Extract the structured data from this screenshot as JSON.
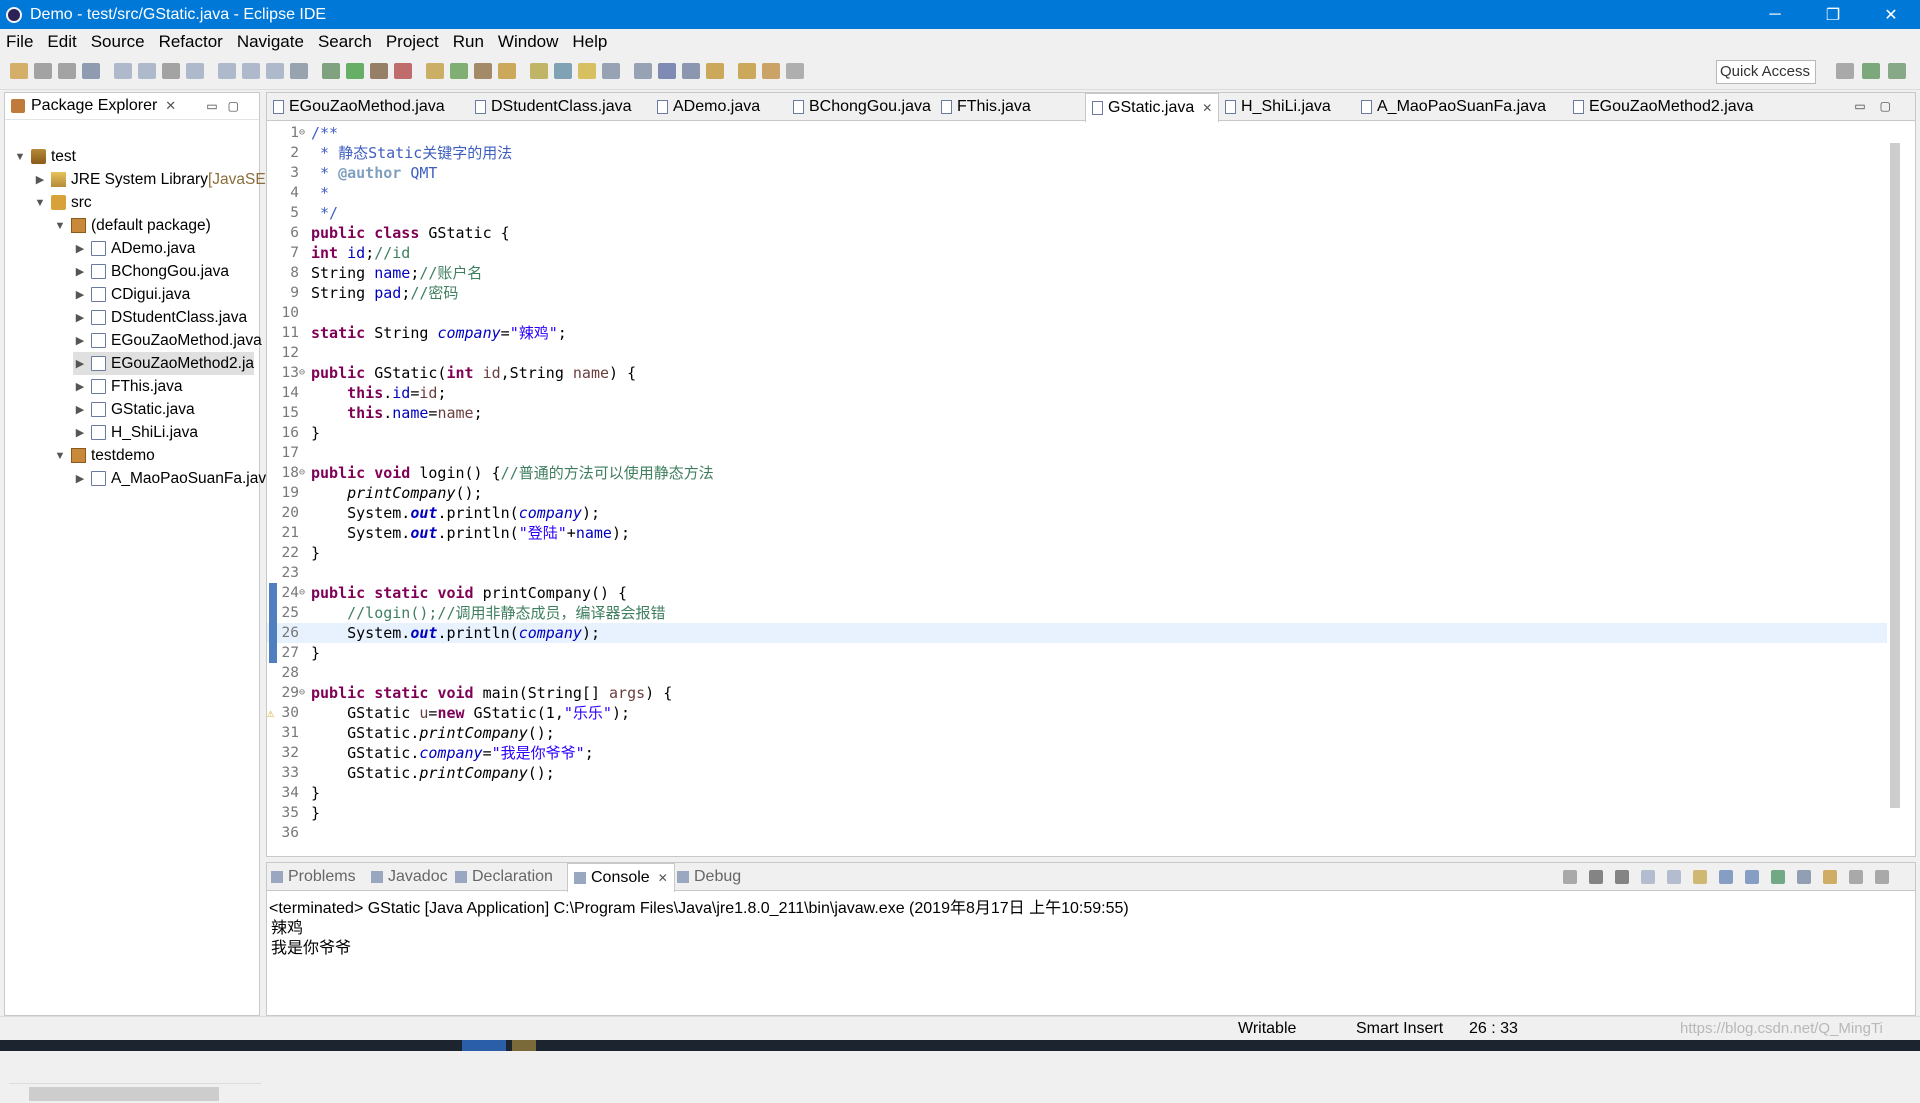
{
  "window": {
    "title": "Demo - test/src/GStatic.java - Eclipse IDE",
    "controls": {
      "minimize": "─",
      "restore": "❐",
      "close": "✕"
    }
  },
  "menu": [
    "File",
    "Edit",
    "Source",
    "Refactor",
    "Navigate",
    "Search",
    "Project",
    "Run",
    "Window",
    "Help"
  ],
  "quick_access": "Quick Access",
  "package_explorer": {
    "title": "Package Explorer",
    "tree": [
      {
        "label": "test",
        "depth": 0,
        "expanded": true,
        "icon": "project-icon"
      },
      {
        "label": "JRE System Library",
        "suffix": "[JavaSE",
        "depth": 1,
        "expanded": false,
        "icon": "library-icon"
      },
      {
        "label": "src",
        "depth": 1,
        "expanded": true,
        "icon": "source-folder-icon"
      },
      {
        "label": "(default package)",
        "depth": 2,
        "expanded": true,
        "icon": "package-icon"
      },
      {
        "label": "ADemo.java",
        "depth": 3,
        "expanded": false,
        "icon": "java-file-icon"
      },
      {
        "label": "BChongGou.java",
        "depth": 3,
        "expanded": false,
        "icon": "java-file-icon"
      },
      {
        "label": "CDigui.java",
        "depth": 3,
        "expanded": false,
        "icon": "java-file-icon"
      },
      {
        "label": "DStudentClass.java",
        "depth": 3,
        "expanded": false,
        "icon": "java-file-icon"
      },
      {
        "label": "EGouZaoMethod.java",
        "depth": 3,
        "expanded": false,
        "icon": "java-file-icon"
      },
      {
        "label": "EGouZaoMethod2.ja",
        "depth": 3,
        "expanded": false,
        "icon": "java-file-icon",
        "selected": true
      },
      {
        "label": "FThis.java",
        "depth": 3,
        "expanded": false,
        "icon": "java-file-icon"
      },
      {
        "label": "GStatic.java",
        "depth": 3,
        "expanded": false,
        "icon": "java-file-icon"
      },
      {
        "label": "H_ShiLi.java",
        "depth": 3,
        "expanded": false,
        "icon": "java-file-icon"
      },
      {
        "label": "testdemo",
        "depth": 2,
        "expanded": true,
        "icon": "package-icon"
      },
      {
        "label": "A_MaoPaoSuanFa.jav",
        "depth": 3,
        "expanded": false,
        "icon": "java-file-icon"
      }
    ]
  },
  "editor": {
    "tabs": [
      {
        "label": "EGouZaoMethod.java"
      },
      {
        "label": "DStudentClass.java"
      },
      {
        "label": "ADemo.java"
      },
      {
        "label": "BChongGou.java"
      },
      {
        "label": "FThis.java"
      },
      {
        "label": "GStatic.java",
        "active": true
      },
      {
        "label": "H_ShiLi.java"
      },
      {
        "label": "A_MaoPaoSuanFa.java"
      },
      {
        "label": "EGouZaoMethod2.java"
      }
    ],
    "current_line": 26,
    "lines": [
      {
        "n": "1",
        "fold": "⊖",
        "parts": [
          [
            "jd",
            "/**"
          ]
        ]
      },
      {
        "n": "2",
        "parts": [
          [
            "jd",
            " * 静态Static关键字的用法"
          ]
        ]
      },
      {
        "n": "3",
        "parts": [
          [
            "jd",
            " * "
          ],
          [
            "jt",
            "@author"
          ],
          [
            "jd",
            " QMT"
          ]
        ]
      },
      {
        "n": "4",
        "parts": [
          [
            "jd",
            " *"
          ]
        ]
      },
      {
        "n": "5",
        "parts": [
          [
            "jd",
            " */"
          ]
        ]
      },
      {
        "n": "6",
        "parts": [
          [
            "k",
            "public"
          ],
          [
            "",
            " "
          ],
          [
            "k",
            "class"
          ],
          [
            "",
            " GStatic {"
          ]
        ]
      },
      {
        "n": "7",
        "parts": [
          [
            "k",
            "int"
          ],
          [
            "",
            " "
          ],
          [
            "f",
            "id"
          ],
          [
            "",
            ";"
          ],
          [
            "c",
            "//id"
          ]
        ]
      },
      {
        "n": "8",
        "parts": [
          [
            "",
            "String "
          ],
          [
            "f",
            "name"
          ],
          [
            "",
            ";"
          ],
          [
            "c",
            "//账户名"
          ]
        ]
      },
      {
        "n": "9",
        "parts": [
          [
            "",
            "String "
          ],
          [
            "f",
            "pad"
          ],
          [
            "",
            ";"
          ],
          [
            "c",
            "//密码"
          ]
        ]
      },
      {
        "n": "10",
        "parts": []
      },
      {
        "n": "11",
        "parts": [
          [
            "k",
            "static"
          ],
          [
            "",
            " String "
          ],
          [
            "sf",
            "company"
          ],
          [
            "",
            "="
          ],
          [
            "s",
            "\"辣鸡\""
          ],
          [
            "",
            ";"
          ]
        ]
      },
      {
        "n": "12",
        "parts": []
      },
      {
        "n": "13",
        "fold": "⊖",
        "parts": [
          [
            "k",
            "public"
          ],
          [
            "",
            " GStatic("
          ],
          [
            "k",
            "int"
          ],
          [
            "",
            " "
          ],
          [
            "lv",
            "id"
          ],
          [
            "",
            ",String "
          ],
          [
            "lv",
            "name"
          ],
          [
            "",
            ") {"
          ]
        ]
      },
      {
        "n": "14",
        "parts": [
          [
            "",
            "    "
          ],
          [
            "k",
            "this"
          ],
          [
            "",
            "."
          ],
          [
            "f",
            "id"
          ],
          [
            "",
            "="
          ],
          [
            "lv",
            "id"
          ],
          [
            "",
            ";"
          ]
        ]
      },
      {
        "n": "15",
        "parts": [
          [
            "",
            "    "
          ],
          [
            "k",
            "this"
          ],
          [
            "",
            "."
          ],
          [
            "f",
            "name"
          ],
          [
            "",
            "="
          ],
          [
            "lv",
            "name"
          ],
          [
            "",
            ";"
          ]
        ]
      },
      {
        "n": "16",
        "parts": [
          [
            "",
            "}"
          ]
        ]
      },
      {
        "n": "17",
        "parts": []
      },
      {
        "n": "18",
        "fold": "⊖",
        "parts": [
          [
            "k",
            "public"
          ],
          [
            "",
            " "
          ],
          [
            "k",
            "void"
          ],
          [
            "",
            " login() {"
          ],
          [
            "c",
            "//普通的方法可以使用静态方法"
          ]
        ]
      },
      {
        "n": "19",
        "parts": [
          [
            "",
            "    "
          ],
          [
            "sm",
            "printCompany"
          ],
          [
            "",
            "();"
          ]
        ]
      },
      {
        "n": "20",
        "parts": [
          [
            "",
            "    System."
          ],
          [
            "sfo",
            "out"
          ],
          [
            "",
            ".println("
          ],
          [
            "sf",
            "company"
          ],
          [
            "",
            ");"
          ]
        ]
      },
      {
        "n": "21",
        "parts": [
          [
            "",
            "    System."
          ],
          [
            "sfo",
            "out"
          ],
          [
            "",
            ".println("
          ],
          [
            "s",
            "\"登陆\""
          ],
          [
            "",
            "+"
          ],
          [
            "f",
            "name"
          ],
          [
            "",
            ");"
          ]
        ]
      },
      {
        "n": "22",
        "parts": [
          [
            "",
            "}"
          ]
        ]
      },
      {
        "n": "23",
        "parts": []
      },
      {
        "n": "24",
        "fold": "⊖",
        "parts": [
          [
            "k",
            "public"
          ],
          [
            "",
            " "
          ],
          [
            "k",
            "static"
          ],
          [
            "",
            " "
          ],
          [
            "k",
            "void"
          ],
          [
            "",
            " printCompany() {"
          ]
        ]
      },
      {
        "n": "25",
        "parts": [
          [
            "",
            "    "
          ],
          [
            "c",
            "//login();//调用非静态成员，编译器会报错"
          ]
        ]
      },
      {
        "n": "26",
        "parts": [
          [
            "",
            "    System."
          ],
          [
            "sfo",
            "out"
          ],
          [
            "",
            ".println("
          ],
          [
            "sf",
            "company"
          ],
          [
            "",
            ");"
          ]
        ]
      },
      {
        "n": "27",
        "parts": [
          [
            "",
            "}"
          ]
        ]
      },
      {
        "n": "28",
        "parts": []
      },
      {
        "n": "29",
        "fold": "⊖",
        "parts": [
          [
            "k",
            "public"
          ],
          [
            "",
            " "
          ],
          [
            "k",
            "static"
          ],
          [
            "",
            " "
          ],
          [
            "k",
            "void"
          ],
          [
            "",
            " main(String[] "
          ],
          [
            "lv",
            "args"
          ],
          [
            "",
            ") {"
          ]
        ]
      },
      {
        "n": "30",
        "warn": true,
        "parts": [
          [
            "",
            "    GStatic "
          ],
          [
            "lv",
            "u"
          ],
          [
            "",
            "="
          ],
          [
            "k",
            "new"
          ],
          [
            "",
            " GStatic(1,"
          ],
          [
            "s",
            "\"乐乐\""
          ],
          [
            "",
            ");"
          ]
        ]
      },
      {
        "n": "31",
        "parts": [
          [
            "",
            "    GStatic."
          ],
          [
            "sm",
            "printCompany"
          ],
          [
            "",
            "();"
          ]
        ]
      },
      {
        "n": "32",
        "parts": [
          [
            "",
            "    GStatic."
          ],
          [
            "sf",
            "company"
          ],
          [
            "",
            "="
          ],
          [
            "s",
            "\"我是你爷爷\""
          ],
          [
            "",
            ";"
          ]
        ]
      },
      {
        "n": "33",
        "parts": [
          [
            "",
            "    GStatic."
          ],
          [
            "sm",
            "printCompany"
          ],
          [
            "",
            "();"
          ]
        ]
      },
      {
        "n": "34",
        "parts": [
          [
            "",
            "}"
          ]
        ]
      },
      {
        "n": "35",
        "parts": [
          [
            "",
            "}"
          ]
        ]
      },
      {
        "n": "36",
        "parts": []
      }
    ]
  },
  "console": {
    "tabs": [
      {
        "label": "Problems"
      },
      {
        "label": "Javadoc"
      },
      {
        "label": "Declaration"
      },
      {
        "label": "Console",
        "active": true
      },
      {
        "label": "Debug"
      }
    ],
    "terminated": "<terminated> GStatic [Java Application] C:\\Program Files\\Java\\jre1.8.0_211\\bin\\javaw.exe (2019年8月17日 上午10:59:55)",
    "output": [
      "辣鸡",
      "我是你爷爷"
    ]
  },
  "status": {
    "writable": "Writable",
    "insert_mode": "Smart Insert",
    "position": "26 : 33"
  },
  "watermark": "https://blog.csdn.net/Q_MingTi",
  "colors": {
    "titlebar": "#0078d7",
    "keyword": "#7f0055",
    "comment": "#3f7f5f",
    "javadoc": "#3f5fbf",
    "string": "#2a00ff",
    "field": "#0000c0",
    "current_line": "#e8f2fe"
  }
}
